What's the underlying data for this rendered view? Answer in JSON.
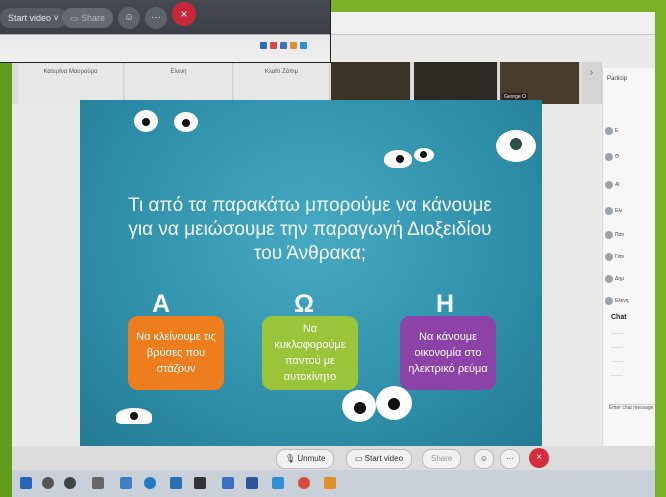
{
  "overlay": {
    "start_video": "Start video",
    "share": "Share",
    "end": "×"
  },
  "participants_strip": [
    {
      "name": "Κατερίνα Μαυρούρα"
    },
    {
      "name": "Ελενη"
    },
    {
      "name": "Κλαίτι Ζάπιμ"
    },
    {
      "name": ""
    },
    {
      "name": ""
    },
    {
      "name": "George O"
    }
  ],
  "slide": {
    "question": "Τι από τα παρακάτω μπορούμε να κάνουμε για να μειώσουμε την παραγωγή Διοξειδίου του Άνθρακα;",
    "options": [
      {
        "letter": "Α",
        "text": "Να κλείνουμε τις βρύσες που στάζουν",
        "color": "#ee7d1d"
      },
      {
        "letter": "Ω",
        "text": "Να κυκλοφορούμε παντού με αυτοκίνητο",
        "color": "#9ac43a"
      },
      {
        "letter": "Η",
        "text": "Να κάνουμε οικονομία στο ηλεκτρικό ρεύμα",
        "color": "#8d42a8"
      }
    ]
  },
  "panel": {
    "title": "Particip",
    "rows": [
      "Ε",
      "Θ",
      "Al",
      "Ελι",
      "Παν",
      "Γιάν",
      "Δημ",
      "Ελενη"
    ],
    "chat_title": "Chat",
    "chat_input": "Enter chat message"
  },
  "controls": {
    "unmute": "Unmute",
    "start_video": "Start video",
    "share": "Share",
    "end": "×"
  },
  "colors": {
    "slide_bg": "#2f8fa9",
    "accent_end": "#d72b3f"
  }
}
